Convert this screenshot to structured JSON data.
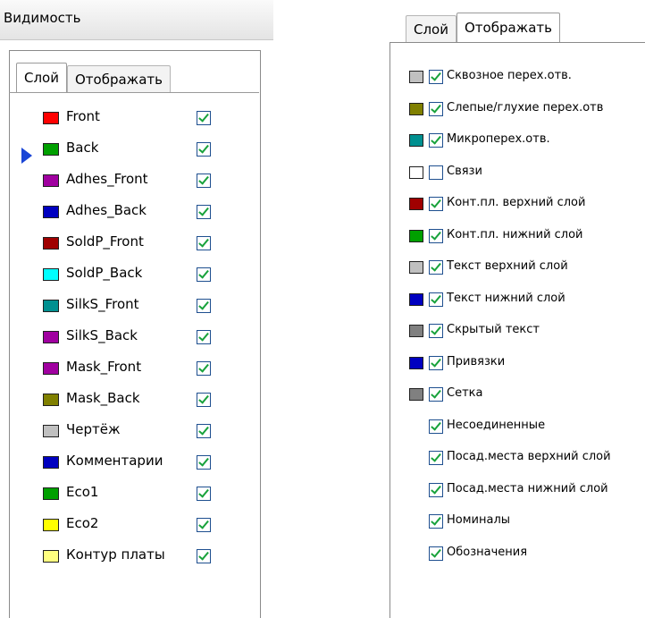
{
  "left": {
    "title": "Видимость",
    "tabs": [
      "Слой",
      "Отображать"
    ],
    "layers": [
      {
        "name": "Front",
        "color": "#ff0000",
        "checked": true
      },
      {
        "name": "Back",
        "color": "#00a000",
        "checked": true
      },
      {
        "name": "Adhes_Front",
        "color": "#a000a0",
        "checked": true
      },
      {
        "name": "Adhes_Back",
        "color": "#0000c0",
        "checked": true
      },
      {
        "name": "SoldP_Front",
        "color": "#a00000",
        "checked": true
      },
      {
        "name": "SoldP_Back",
        "color": "#00ffff",
        "checked": true
      },
      {
        "name": "SilkS_Front",
        "color": "#009090",
        "checked": true
      },
      {
        "name": "SilkS_Back",
        "color": "#a000a0",
        "checked": true
      },
      {
        "name": "Mask_Front",
        "color": "#a000a0",
        "checked": true
      },
      {
        "name": "Mask_Back",
        "color": "#808000",
        "checked": true
      },
      {
        "name": "Чертёж",
        "color": "#c0c0c0",
        "checked": true
      },
      {
        "name": "Комментарии",
        "color": "#0000c0",
        "checked": true
      },
      {
        "name": "Eco1",
        "color": "#00a000",
        "checked": true
      },
      {
        "name": "Eco2",
        "color": "#ffff00",
        "checked": true
      },
      {
        "name": "Контур платы",
        "color": "#ffff80",
        "checked": true
      }
    ]
  },
  "right": {
    "tabs": [
      "Слой",
      "Отображать"
    ],
    "items": [
      {
        "name": "Сквозное перех.отв.",
        "color": "#c0c0c0",
        "checked": true
      },
      {
        "name": "Слепые/глухие перех.отв",
        "color": "#808000",
        "checked": true
      },
      {
        "name": "Микроперех.отв.",
        "color": "#009090",
        "checked": true
      },
      {
        "name": "Связи",
        "color": "#ffffff",
        "checked": false
      },
      {
        "name": "Конт.пл. верхний слой",
        "color": "#a00000",
        "checked": true
      },
      {
        "name": "Конт.пл. нижний слой",
        "color": "#00a000",
        "checked": true
      },
      {
        "name": "Текст верхний слой",
        "color": "#c0c0c0",
        "checked": true
      },
      {
        "name": "Текст нижний слой",
        "color": "#0000c0",
        "checked": true
      },
      {
        "name": "Скрытый текст",
        "color": "#808080",
        "checked": true
      },
      {
        "name": "Привязки",
        "color": "#0000c0",
        "checked": true
      },
      {
        "name": "Сетка",
        "color": "#808080",
        "checked": true
      },
      {
        "name": "Несоединенные",
        "color": null,
        "checked": true
      },
      {
        "name": "Посад.места верхний слой",
        "color": null,
        "checked": true
      },
      {
        "name": "Посад.места нижний слой",
        "color": null,
        "checked": true
      },
      {
        "name": "Номиналы",
        "color": null,
        "checked": true
      },
      {
        "name": "Обозначения",
        "color": null,
        "checked": true
      }
    ]
  }
}
